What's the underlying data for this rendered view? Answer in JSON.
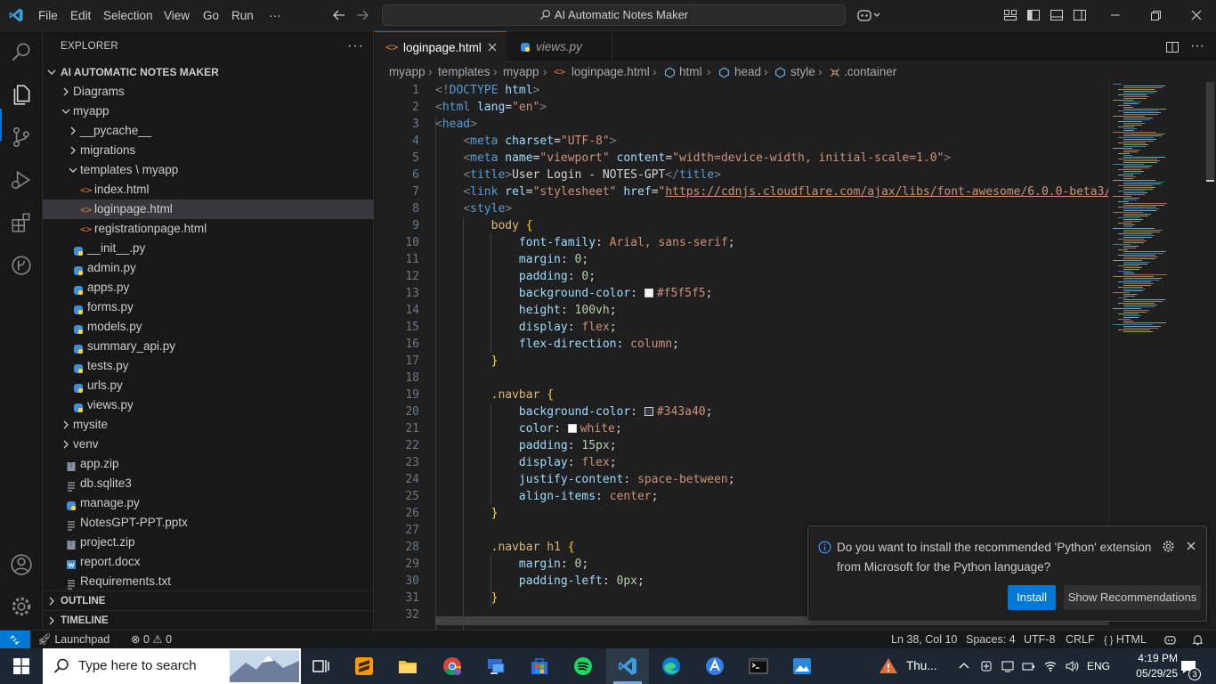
{
  "menu": [
    "File",
    "Edit",
    "Selection",
    "View",
    "Go",
    "Run",
    "···"
  ],
  "command_center": "AI Automatic Notes Maker",
  "explorer": {
    "title": "EXPLORER",
    "more": "···",
    "project": "AI AUTOMATIC NOTES MAKER",
    "items": [
      {
        "label": "Diagrams",
        "type": "folder",
        "depth": 0,
        "open": false
      },
      {
        "label": "myapp",
        "type": "folder",
        "depth": 0,
        "open": true
      },
      {
        "label": "__pycache__",
        "type": "folder",
        "depth": 1,
        "open": false
      },
      {
        "label": "migrations",
        "type": "folder",
        "depth": 1,
        "open": false
      },
      {
        "label": "templates \\ myapp",
        "type": "folder",
        "depth": 1,
        "open": true
      },
      {
        "label": "index.html",
        "type": "html",
        "depth": 2
      },
      {
        "label": "loginpage.html",
        "type": "html",
        "depth": 2,
        "selected": true
      },
      {
        "label": "registrationpage.html",
        "type": "html",
        "depth": 2
      },
      {
        "label": "__init__.py",
        "type": "py",
        "depth": 1
      },
      {
        "label": "admin.py",
        "type": "py",
        "depth": 1
      },
      {
        "label": "apps.py",
        "type": "py",
        "depth": 1
      },
      {
        "label": "forms.py",
        "type": "py",
        "depth": 1
      },
      {
        "label": "models.py",
        "type": "py",
        "depth": 1
      },
      {
        "label": "summary_api.py",
        "type": "py",
        "depth": 1
      },
      {
        "label": "tests.py",
        "type": "py",
        "depth": 1
      },
      {
        "label": "urls.py",
        "type": "py",
        "depth": 1
      },
      {
        "label": "views.py",
        "type": "py",
        "depth": 1
      },
      {
        "label": "mysite",
        "type": "folder",
        "depth": 0,
        "open": false
      },
      {
        "label": "venv",
        "type": "folder",
        "depth": 0,
        "open": false
      },
      {
        "label": "app.zip",
        "type": "zip",
        "depth": 0
      },
      {
        "label": "db.sqlite3",
        "type": "text",
        "depth": 0
      },
      {
        "label": "manage.py",
        "type": "py",
        "depth": 0
      },
      {
        "label": "NotesGPT-PPT.pptx",
        "type": "text",
        "depth": 0
      },
      {
        "label": "project.zip",
        "type": "zip",
        "depth": 0
      },
      {
        "label": "report.docx",
        "type": "docx",
        "depth": 0
      },
      {
        "label": "Requirements.txt",
        "type": "text",
        "depth": 0
      }
    ],
    "outline": "OUTLINE",
    "timeline": "TIMELINE"
  },
  "tabs": [
    {
      "label": "loginpage.html",
      "active": true
    },
    {
      "label": "views.py",
      "active": false
    }
  ],
  "breadcrumb": [
    "myapp",
    "templates",
    "myapp",
    "loginpage.html",
    "html",
    "head",
    "style",
    ".container"
  ],
  "code": {
    "line_numbers": [
      "1",
      "2",
      "3",
      "4",
      "5",
      "6",
      "7",
      "8",
      "9",
      "10",
      "11",
      "12",
      "13",
      "14",
      "15",
      "16",
      "17",
      "18",
      "19",
      "20",
      "21",
      "22",
      "23",
      "24",
      "25",
      "26",
      "27",
      "28",
      "29",
      "30",
      "31",
      "32"
    ],
    "lines": [
      [
        [
          "br",
          "<!"
        ],
        [
          "tag",
          "DOCTYPE"
        ],
        [
          "punc",
          " "
        ],
        [
          "attr",
          "html"
        ],
        [
          "br",
          ">"
        ]
      ],
      [
        [
          "br",
          "<"
        ],
        [
          "tag",
          "html"
        ],
        [
          "punc",
          " "
        ],
        [
          "attr",
          "lang"
        ],
        [
          "punc",
          "="
        ],
        [
          "str",
          "\"en\""
        ],
        [
          "br",
          ">"
        ]
      ],
      [
        [
          "br",
          "<"
        ],
        [
          "tag",
          "head"
        ],
        [
          "br",
          ">"
        ]
      ],
      [
        [
          "punc",
          "    "
        ],
        [
          "br",
          "<"
        ],
        [
          "tag",
          "meta"
        ],
        [
          "punc",
          " "
        ],
        [
          "attr",
          "charset"
        ],
        [
          "punc",
          "="
        ],
        [
          "str",
          "\"UTF-8\""
        ],
        [
          "br",
          ">"
        ]
      ],
      [
        [
          "punc",
          "    "
        ],
        [
          "br",
          "<"
        ],
        [
          "tag",
          "meta"
        ],
        [
          "punc",
          " "
        ],
        [
          "attr",
          "name"
        ],
        [
          "punc",
          "="
        ],
        [
          "str",
          "\"viewport\""
        ],
        [
          "punc",
          " "
        ],
        [
          "attr",
          "content"
        ],
        [
          "punc",
          "="
        ],
        [
          "str",
          "\"width=device-width, initial-scale=1.0\""
        ],
        [
          "br",
          ">"
        ]
      ],
      [
        [
          "punc",
          "    "
        ],
        [
          "br",
          "<"
        ],
        [
          "tag",
          "title"
        ],
        [
          "br",
          ">"
        ],
        [
          "punc",
          "User Login - NOTES-GPT"
        ],
        [
          "br",
          "</"
        ],
        [
          "tag",
          "title"
        ],
        [
          "br",
          ">"
        ]
      ],
      [
        [
          "punc",
          "    "
        ],
        [
          "br",
          "<"
        ],
        [
          "tag",
          "link"
        ],
        [
          "punc",
          " "
        ],
        [
          "attr",
          "rel"
        ],
        [
          "punc",
          "="
        ],
        [
          "str",
          "\"stylesheet\""
        ],
        [
          "punc",
          " "
        ],
        [
          "attr",
          "href"
        ],
        [
          "punc",
          "="
        ],
        [
          "str",
          "\""
        ],
        [
          "link",
          "https://cdnjs.cloudflare.com/ajax/libs/font-awesome/6.0.0-beta3/c"
        ]
      ],
      [
        [
          "punc",
          "    "
        ],
        [
          "br",
          "<"
        ],
        [
          "tag",
          "style"
        ],
        [
          "br",
          ">"
        ]
      ],
      [
        [
          "punc",
          "        "
        ],
        [
          "sel",
          "body"
        ],
        [
          "punc",
          " "
        ],
        [
          "brace",
          "{"
        ]
      ],
      [
        [
          "punc",
          "            "
        ],
        [
          "prop",
          "font-family"
        ],
        [
          "punc",
          ": "
        ],
        [
          "val",
          "Arial, sans-serif"
        ],
        [
          "punc",
          ";"
        ]
      ],
      [
        [
          "punc",
          "            "
        ],
        [
          "prop",
          "margin"
        ],
        [
          "punc",
          ": "
        ],
        [
          "num",
          "0"
        ],
        [
          "punc",
          ";"
        ]
      ],
      [
        [
          "punc",
          "            "
        ],
        [
          "prop",
          "padding"
        ],
        [
          "punc",
          ": "
        ],
        [
          "num",
          "0"
        ],
        [
          "punc",
          ";"
        ]
      ],
      [
        [
          "punc",
          "            "
        ],
        [
          "prop",
          "background-color"
        ],
        [
          "punc",
          ": "
        ],
        [
          "swatch",
          "#f5f5f5"
        ],
        [
          "val",
          "#f5f5f5"
        ],
        [
          "punc",
          ";"
        ]
      ],
      [
        [
          "punc",
          "            "
        ],
        [
          "prop",
          "height"
        ],
        [
          "punc",
          ": "
        ],
        [
          "num",
          "100vh"
        ],
        [
          "punc",
          ";"
        ]
      ],
      [
        [
          "punc",
          "            "
        ],
        [
          "prop",
          "display"
        ],
        [
          "punc",
          ": "
        ],
        [
          "val",
          "flex"
        ],
        [
          "punc",
          ";"
        ]
      ],
      [
        [
          "punc",
          "            "
        ],
        [
          "prop",
          "flex-direction"
        ],
        [
          "punc",
          ": "
        ],
        [
          "val",
          "column"
        ],
        [
          "punc",
          ";"
        ]
      ],
      [
        [
          "punc",
          "        "
        ],
        [
          "brace",
          "}"
        ]
      ],
      [],
      [
        [
          "punc",
          "        "
        ],
        [
          "sel",
          ".navbar"
        ],
        [
          "punc",
          " "
        ],
        [
          "brace",
          "{"
        ]
      ],
      [
        [
          "punc",
          "            "
        ],
        [
          "prop",
          "background-color"
        ],
        [
          "punc",
          ": "
        ],
        [
          "swatch",
          "#343a40"
        ],
        [
          "val",
          "#343a40"
        ],
        [
          "punc",
          ";"
        ]
      ],
      [
        [
          "punc",
          "            "
        ],
        [
          "prop",
          "color"
        ],
        [
          "punc",
          ": "
        ],
        [
          "swatch",
          "#ffffff"
        ],
        [
          "val",
          "white"
        ],
        [
          "punc",
          ";"
        ]
      ],
      [
        [
          "punc",
          "            "
        ],
        [
          "prop",
          "padding"
        ],
        [
          "punc",
          ": "
        ],
        [
          "num",
          "15px"
        ],
        [
          "punc",
          ";"
        ]
      ],
      [
        [
          "punc",
          "            "
        ],
        [
          "prop",
          "display"
        ],
        [
          "punc",
          ": "
        ],
        [
          "val",
          "flex"
        ],
        [
          "punc",
          ";"
        ]
      ],
      [
        [
          "punc",
          "            "
        ],
        [
          "prop",
          "justify-content"
        ],
        [
          "punc",
          ": "
        ],
        [
          "val",
          "space-between"
        ],
        [
          "punc",
          ";"
        ]
      ],
      [
        [
          "punc",
          "            "
        ],
        [
          "prop",
          "align-items"
        ],
        [
          "punc",
          ": "
        ],
        [
          "val",
          "center"
        ],
        [
          "punc",
          ";"
        ]
      ],
      [
        [
          "punc",
          "        "
        ],
        [
          "brace",
          "}"
        ]
      ],
      [],
      [
        [
          "punc",
          "        "
        ],
        [
          "sel",
          ".navbar h1"
        ],
        [
          "punc",
          " "
        ],
        [
          "brace",
          "{"
        ]
      ],
      [
        [
          "punc",
          "            "
        ],
        [
          "prop",
          "margin"
        ],
        [
          "punc",
          ": "
        ],
        [
          "num",
          "0"
        ],
        [
          "punc",
          ";"
        ]
      ],
      [
        [
          "punc",
          "            "
        ],
        [
          "prop",
          "padding-left"
        ],
        [
          "punc",
          ": "
        ],
        [
          "num",
          "0px"
        ],
        [
          "punc",
          ";"
        ]
      ],
      [
        [
          "punc",
          "        "
        ],
        [
          "brace",
          "}"
        ]
      ],
      []
    ]
  },
  "notification": {
    "message": "Do you want to install the recommended 'Python' extension from Microsoft for the Python language?",
    "install": "Install",
    "show": "Show Recommendations"
  },
  "status": {
    "launchpad": "Launchpad",
    "errors": "0",
    "warnings": "0",
    "position": "Ln 38, Col 10",
    "spaces": "Spaces: 4",
    "encoding": "UTF-8",
    "eol": "CRLF",
    "language": "HTML"
  },
  "taskbar": {
    "search_placeholder": "Type here to search",
    "weather": "Thu...",
    "lang": "ENG",
    "time": "4:19 PM",
    "date": "05/29/25",
    "notif_count": "3"
  },
  "colors": {
    "accent": "#0078d4",
    "html_icon": "#e37933",
    "py_icon": "#3c8fd6"
  }
}
